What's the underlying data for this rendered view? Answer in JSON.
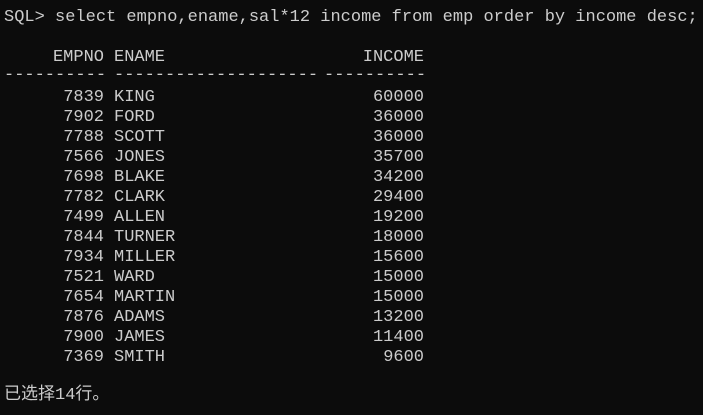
{
  "console": {
    "prompt": "SQL>",
    "command": " select empno,ename,sal*12 income from emp order by income desc;"
  },
  "table": {
    "headers": [
      "EMPNO",
      "ENAME",
      "INCOME"
    ],
    "separators": [
      "----------",
      "--------------------",
      "----------"
    ],
    "rows": [
      {
        "empno": "7839",
        "ename": "KING",
        "income": "60000"
      },
      {
        "empno": "7902",
        "ename": "FORD",
        "income": "36000"
      },
      {
        "empno": "7788",
        "ename": "SCOTT",
        "income": "36000"
      },
      {
        "empno": "7566",
        "ename": "JONES",
        "income": "35700"
      },
      {
        "empno": "7698",
        "ename": "BLAKE",
        "income": "34200"
      },
      {
        "empno": "7782",
        "ename": "CLARK",
        "income": "29400"
      },
      {
        "empno": "7499",
        "ename": "ALLEN",
        "income": "19200"
      },
      {
        "empno": "7844",
        "ename": "TURNER",
        "income": "18000"
      },
      {
        "empno": "7934",
        "ename": "MILLER",
        "income": "15600"
      },
      {
        "empno": "7521",
        "ename": "WARD",
        "income": "15000"
      },
      {
        "empno": "7654",
        "ename": "MARTIN",
        "income": "15000"
      },
      {
        "empno": "7876",
        "ename": "ADAMS",
        "income": "13200"
      },
      {
        "empno": "7900",
        "ename": "JAMES",
        "income": "11400"
      },
      {
        "empno": "7369",
        "ename": "SMITH",
        "income": "9600"
      }
    ]
  },
  "footer": {
    "status": "已选择14行。"
  },
  "colors": {
    "background": "#0c0c0c",
    "text": "#cccccc"
  }
}
